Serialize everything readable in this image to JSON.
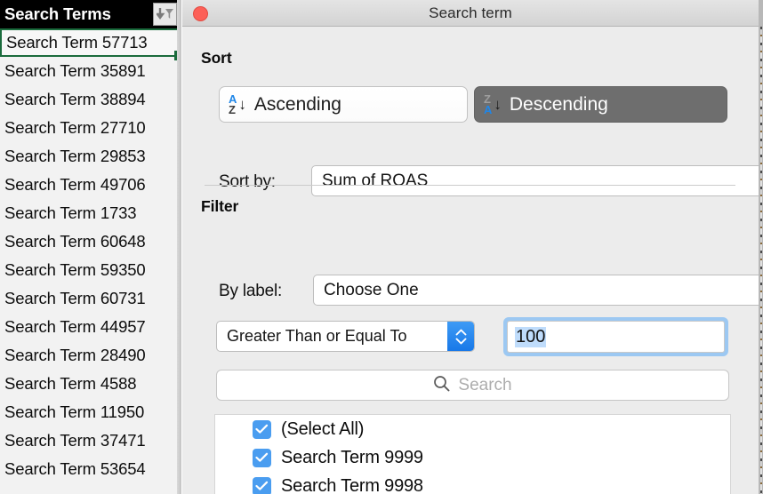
{
  "spreadsheet": {
    "column_header": "Search Terms",
    "filter_icon": "sort-filter-icon",
    "rows": [
      "Search Term 57713",
      "Search Term 35891",
      "Search Term 38894",
      "Search Term 27710",
      "Search Term 29853",
      "Search Term 49706",
      "Search Term 1733",
      "Search Term 60648",
      "Search Term 59350",
      "Search Term 60731",
      "Search Term 44957",
      "Search Term 28490",
      "Search Term 4588",
      "Search Term 11950",
      "Search Term 37471",
      "Search Term 53654"
    ],
    "selected_row_index": 0,
    "selection_color": "#1a6b3c"
  },
  "dialog": {
    "title": "Search term",
    "close_button": "close-window-button",
    "sort": {
      "heading": "Sort",
      "ascending_label": "Ascending",
      "descending_label": "Descending",
      "active": "Descending",
      "ascending_icon": "a-to-z-sort-icon",
      "descending_icon": "z-to-a-sort-icon",
      "sort_by_label": "Sort by:",
      "sort_by_value": "Sum of ROAS"
    },
    "filter": {
      "heading": "Filter",
      "by_label_label": "By label:",
      "by_label_value": "Choose One",
      "operator_value": "Greater Than or Equal To",
      "value_input": "100",
      "search_placeholder": "Search",
      "search_icon": "magnifier-icon",
      "items": [
        {
          "label": "(Select All)",
          "checked": true
        },
        {
          "label": "Search Term 9999",
          "checked": true
        },
        {
          "label": "Search Term 9998",
          "checked": true
        }
      ]
    }
  },
  "colors": {
    "accent_blue": "#1878e8",
    "checkbox_blue": "#4a9df0",
    "close_red": "#fc6058",
    "selection_green": "#1a6b3c",
    "active_segment_gray": "#6e6e6e"
  }
}
